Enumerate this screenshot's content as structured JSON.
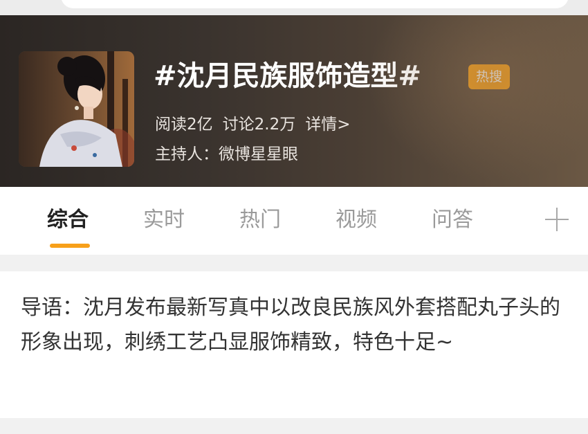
{
  "topic": {
    "title": "#沈月民族服饰造型#",
    "badge": "热搜",
    "reads": "阅读2亿",
    "discussions": "讨论2.2万",
    "details_link": "详情>",
    "host": "主持人：微博星星眼"
  },
  "tabs": [
    {
      "label": "综合",
      "active": true
    },
    {
      "label": "实时",
      "active": false
    },
    {
      "label": "热门",
      "active": false
    },
    {
      "label": "视频",
      "active": false
    },
    {
      "label": "问答",
      "active": false
    }
  ],
  "tab_more_icon": "plus-icon",
  "lead": {
    "text": "导语：沈月发布最新写真中以改良民族风外套搭配丸子头的形象出现，刺绣工艺凸显服饰精致，特色十足~"
  },
  "colors": {
    "accent": "#f7a01a",
    "header_bg": "#2b2623",
    "page_bg": "#f1f1f1"
  }
}
